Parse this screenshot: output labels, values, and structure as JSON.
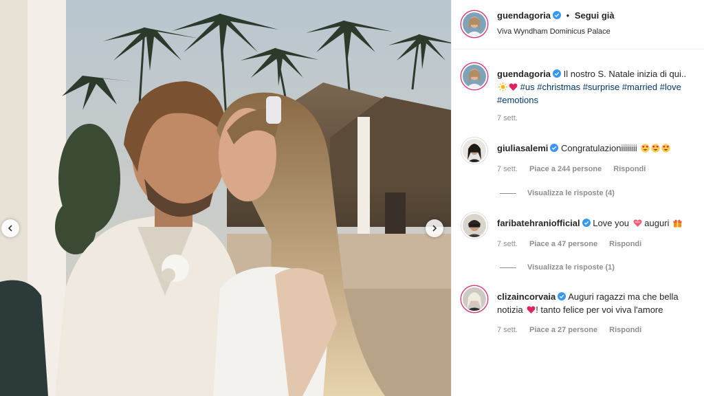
{
  "post": {
    "author": "guendagoria",
    "follow_status": "Segui già",
    "separator": "•",
    "location": "Viva Wyndham Dominicus Palace"
  },
  "caption": {
    "username": "guendagoria",
    "text": "Il nostro S. Natale inizia di qui..",
    "hashtags": [
      "#us",
      "#christmas",
      "#surprise",
      "#married",
      "#love",
      "#emotions"
    ],
    "time": "7 sett."
  },
  "comments": [
    {
      "username": "giuliasalemi",
      "text": "Congratulazioniiiiiiii",
      "time": "7 sett.",
      "likes": "Piace a 244 persone",
      "reply": "Rispondi",
      "view_replies": "Visualizza le risposte (4)",
      "emoji": [
        "heart-eyes-icon",
        "heart-eyes-icon",
        "heart-eyes-icon"
      ]
    },
    {
      "username": "faribatehraniofficial",
      "text": "Love you",
      "text_after": "auguri",
      "time": "7 sett.",
      "likes": "Piace a 47 persone",
      "reply": "Rispondi",
      "view_replies": "Visualizza le risposte (1)"
    },
    {
      "username": "clizaincorvaia",
      "text": "Auguri ragazzi ma che bella notizia",
      "text_after": "! tanto felice per voi viva l'amore",
      "time": "7 sett.",
      "likes": "Piace a 27 persone",
      "reply": "Rispondi"
    }
  ],
  "colors": {
    "story_ring": "#d83a7c",
    "verified": "#3897f0",
    "hashtag": "#00376b",
    "meta": "#8e8e8e"
  }
}
